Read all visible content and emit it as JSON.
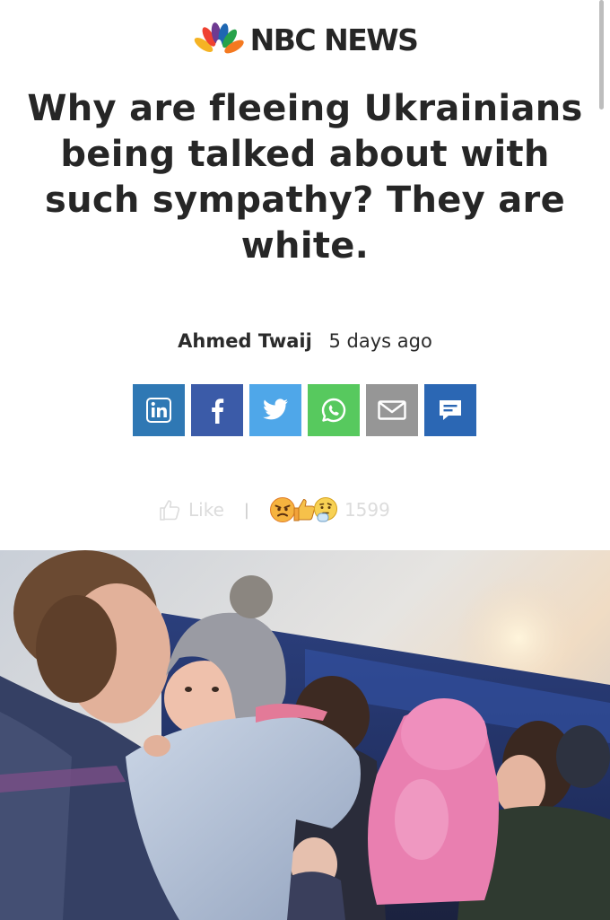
{
  "brand": {
    "name": "NBC NEWS"
  },
  "article": {
    "headline": "Why are fleeing Ukrainians being talked about with such sympathy? They are white.",
    "author": "Ahmed Twaij",
    "time": "5 days ago"
  },
  "share": [
    {
      "name": "linkedin",
      "icon": "linkedin-icon",
      "color": "#2f78b4"
    },
    {
      "name": "facebook",
      "icon": "facebook-icon",
      "color": "#3b5ba8"
    },
    {
      "name": "twitter",
      "icon": "twitter-icon",
      "color": "#4fa7e9"
    },
    {
      "name": "whatsapp",
      "icon": "whatsapp-icon",
      "color": "#57c95e"
    },
    {
      "name": "email",
      "icon": "envelope-icon",
      "color": "#969696"
    },
    {
      "name": "comment",
      "icon": "comment-icon",
      "color": "#2b67b4"
    }
  ],
  "reactions": {
    "like_label": "Like",
    "separator": "|",
    "count": "1599",
    "emojis": [
      "angry-face-icon",
      "thumbs-up-icon",
      "thinking-face-icon"
    ]
  },
  "photo": {
    "subject": "woman-holding-child-image"
  },
  "colors": {
    "brand_text": "#262626",
    "muted": "#dcdcdc"
  }
}
